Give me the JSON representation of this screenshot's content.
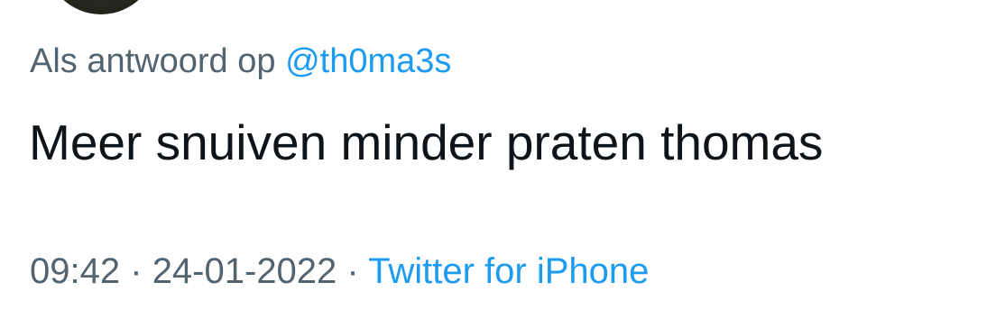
{
  "reply": {
    "prefix": "Als antwoord op",
    "handle": "@th0ma3s"
  },
  "tweet": {
    "text": "Meer snuiven minder praten thomas"
  },
  "meta": {
    "time": "09:42",
    "separator": "·",
    "date": "24-01-2022",
    "source": "Twitter for iPhone"
  },
  "colors": {
    "link": "#1d9bf0",
    "secondary_text": "#536471",
    "primary_text": "#0f1419",
    "background": "#ffffff"
  }
}
